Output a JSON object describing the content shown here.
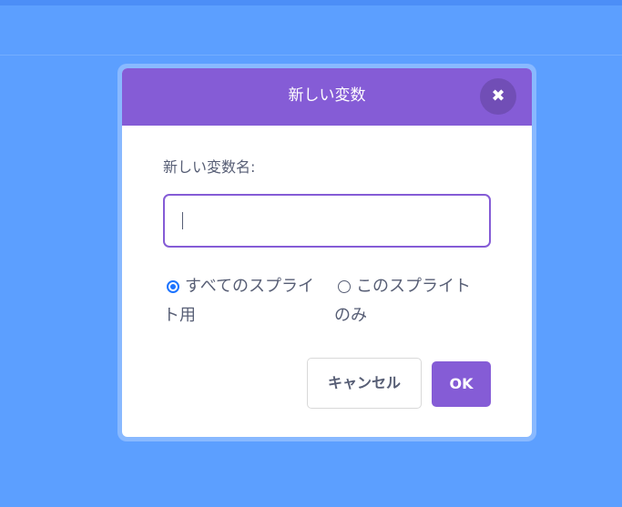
{
  "dialog": {
    "title": "新しい変数",
    "close_icon": "close-icon",
    "field_label": "新しい変数名:",
    "input_value": "",
    "scope_options": [
      {
        "line1": "すべてのスプライ",
        "line2": "ト用",
        "selected": true
      },
      {
        "line1": "このスプライト",
        "line2": "のみ",
        "selected": false
      }
    ],
    "cancel_label": "キャンセル",
    "ok_label": "OK"
  },
  "colors": {
    "background": "#5c9fff",
    "header": "#855cd6",
    "text": "#575e75",
    "radio_selected": "#1d74ff"
  }
}
